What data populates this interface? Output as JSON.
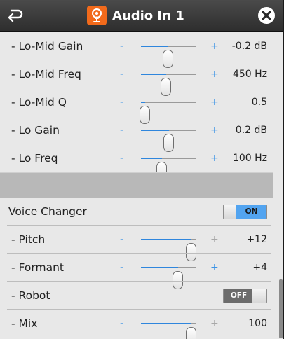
{
  "window": {
    "title": "Audio In 1"
  },
  "icons": {
    "back": "back-arrow-icon",
    "app": "audio-input-icon",
    "close": "close-icon"
  },
  "colors": {
    "accent": "#3b93e6",
    "app_icon_bg": "#f26a1b",
    "toggle_on": "#52a4f0",
    "toggle_off": "#6c6c6c"
  },
  "eq_rows": [
    {
      "label": "- Lo-Mid Gain",
      "minus": "-",
      "plus": "+",
      "value": "-0.2 dB",
      "level": 0.49,
      "active": true
    },
    {
      "label": "- Lo-Mid Freq",
      "minus": "-",
      "plus": "+",
      "value": "450 Hz",
      "level": 0.46,
      "active": true
    },
    {
      "label": "- Lo-Mid Q",
      "minus": "-",
      "plus": "+",
      "value": "0.5",
      "level": 0.08,
      "active": true
    },
    {
      "label": "- Lo Gain",
      "minus": "-",
      "plus": "+",
      "value": "0.2 dB",
      "level": 0.51,
      "active": true
    },
    {
      "label": "- Lo Freq",
      "minus": "-",
      "plus": "+",
      "value": "100 Hz",
      "level": 0.38,
      "active": true
    }
  ],
  "voice_changer": {
    "label": "Voice Changer",
    "toggle": "ON",
    "enabled": true
  },
  "vc_rows": [
    {
      "label": "- Pitch",
      "minus": "-",
      "plus": "+",
      "value": "+12",
      "level": 0.91,
      "active": false
    },
    {
      "label": "- Formant",
      "minus": "-",
      "plus": "+",
      "value": "+4",
      "level": 0.67,
      "active": true
    },
    {
      "label": "- Robot",
      "toggle": "OFF",
      "enabled": false
    },
    {
      "label": "- Mix",
      "minus": "-",
      "plus": "+",
      "value": "100",
      "level": 0.91,
      "active": false
    }
  ]
}
